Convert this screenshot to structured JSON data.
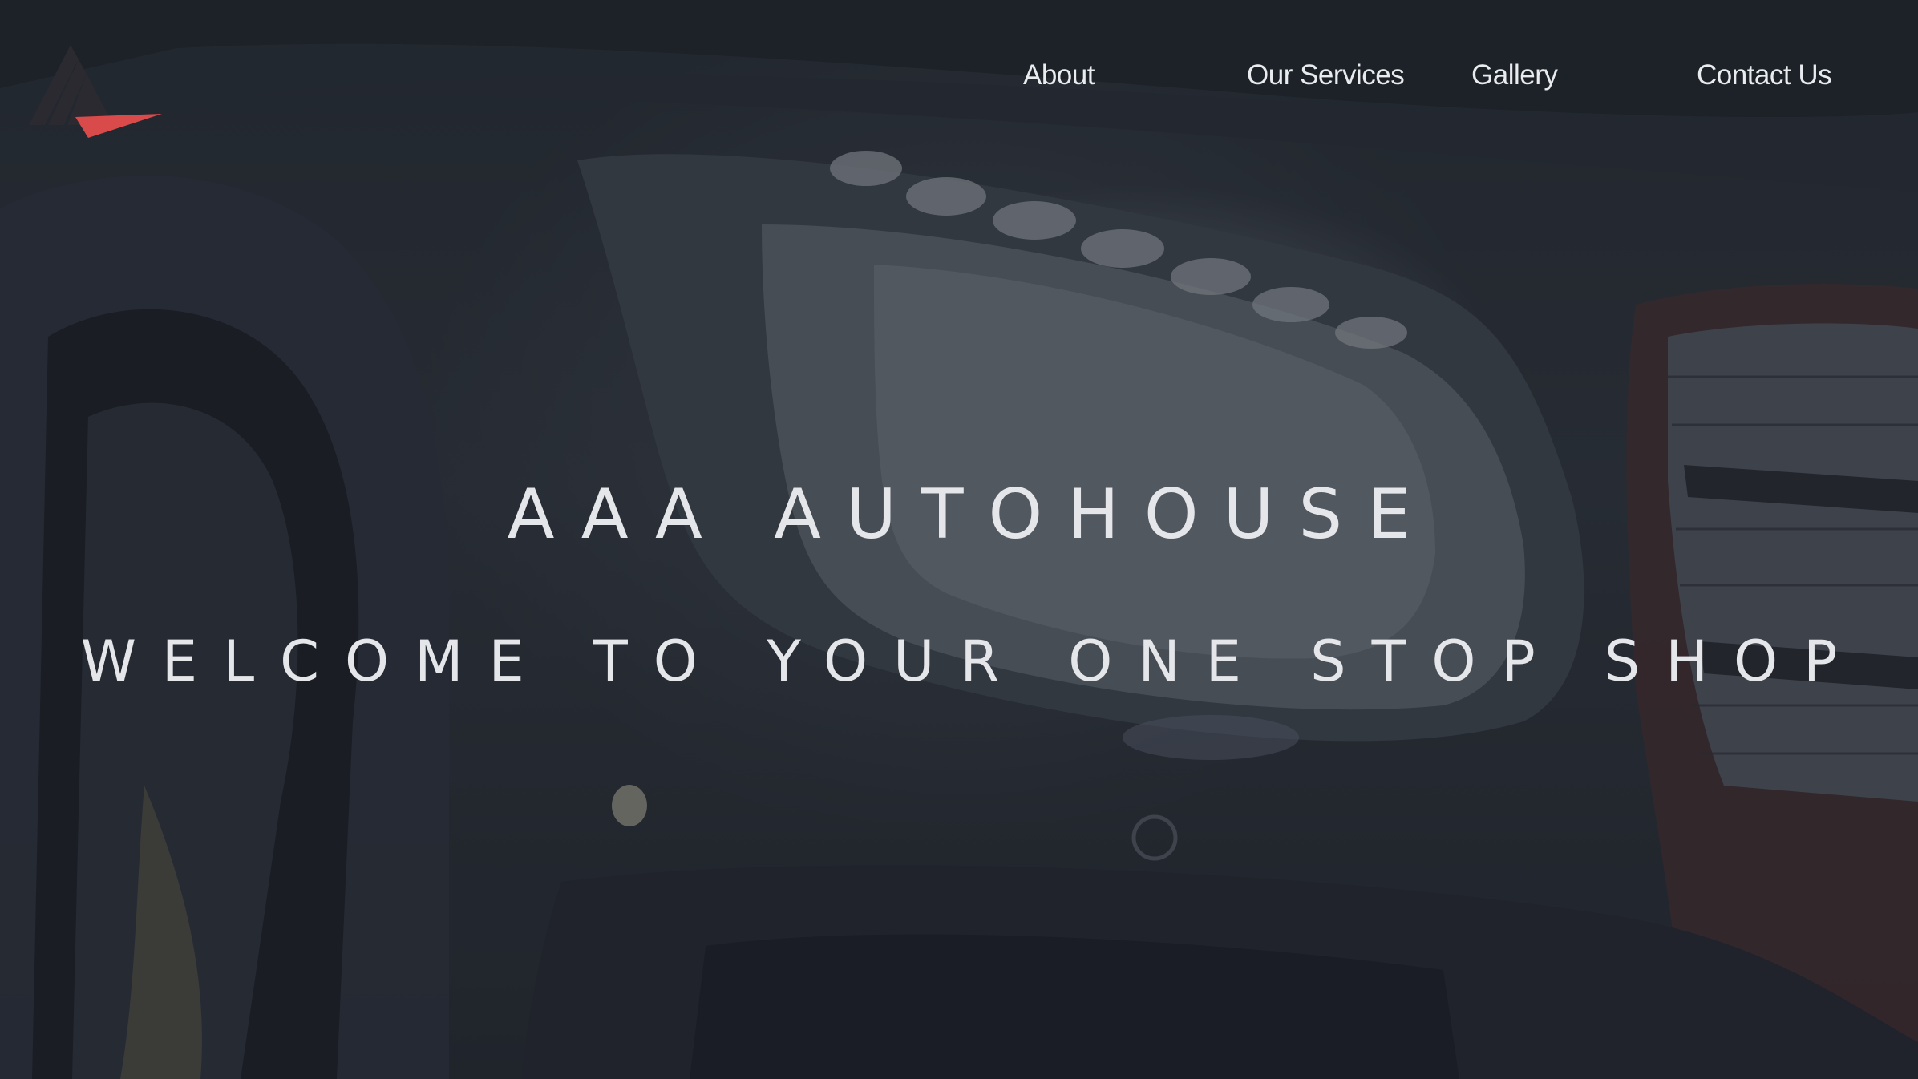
{
  "nav": {
    "items": [
      {
        "label": "About"
      },
      {
        "label": "Our Services"
      },
      {
        "label": "Gallery"
      },
      {
        "label": "Contact Us"
      }
    ]
  },
  "hero": {
    "title": "AAA AUTOHOUSE",
    "subtitle": "WELCOME TO YOUR ONE STOP SHOP",
    "background": "car-headlight-photo"
  },
  "logo": {
    "icon": "mountain-logo-icon",
    "accent_color": "#d94a4a",
    "mark_color": "#2a2a30"
  }
}
